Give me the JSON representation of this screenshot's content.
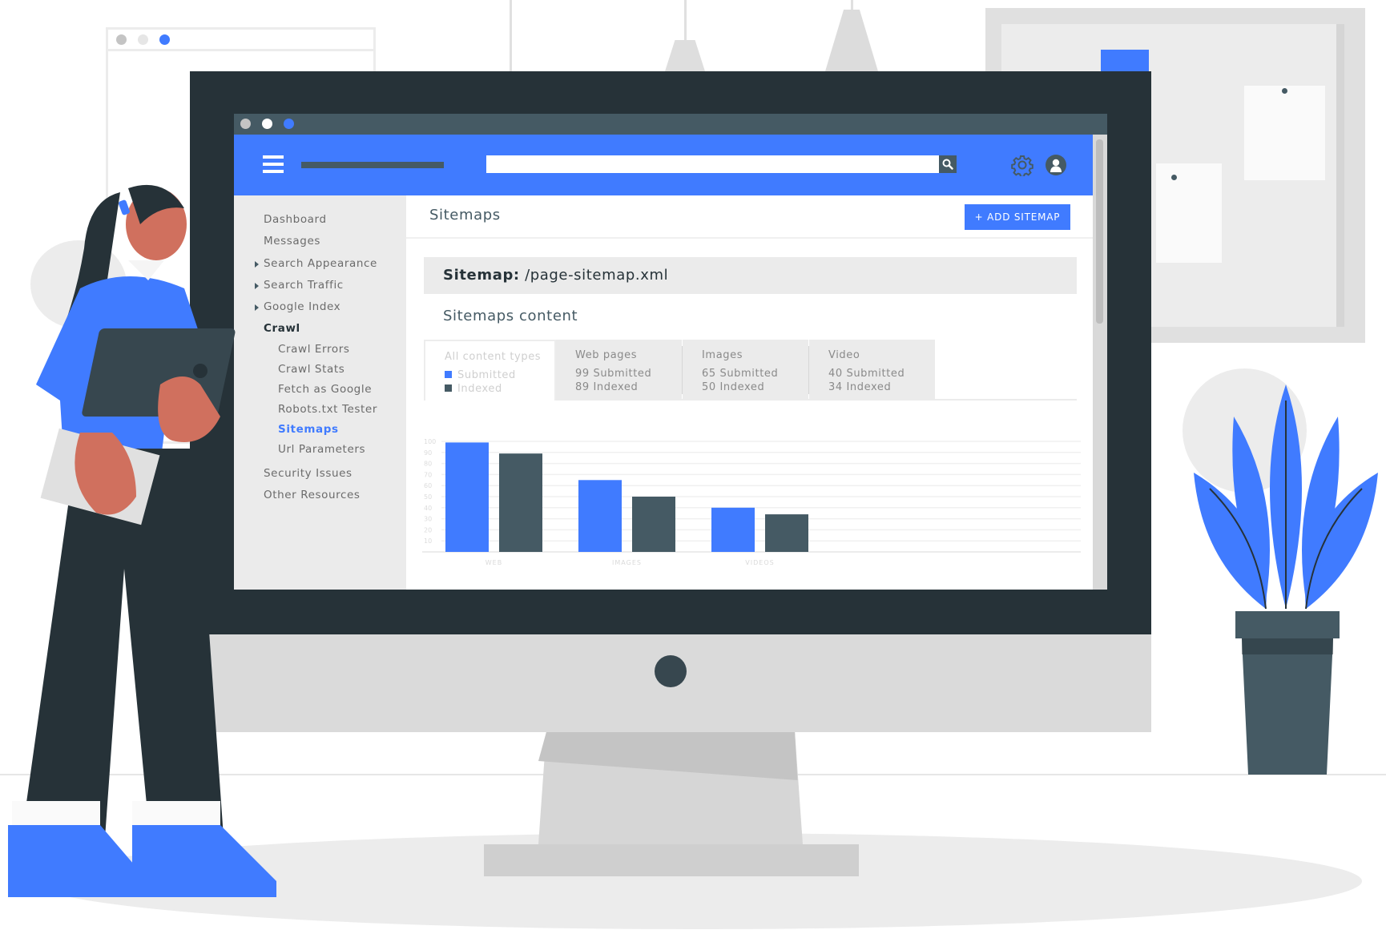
{
  "window": {
    "dots": [
      {
        "name": "close",
        "color": "#c4c4c4"
      },
      {
        "name": "minimize",
        "color": "#ffffff"
      },
      {
        "name": "maximize",
        "color": "#407bff"
      }
    ]
  },
  "colors": {
    "accent": "#407bff",
    "dark": "#455a64",
    "frame": "#263238",
    "sidebar_bg": "#ebebeb"
  },
  "header": {
    "search": {
      "value": "",
      "placeholder": ""
    },
    "icons": [
      "menu-icon",
      "search-icon",
      "gear-icon",
      "user-avatar-icon"
    ]
  },
  "sidebar": {
    "items": [
      {
        "label": "Dashboard",
        "type": "item"
      },
      {
        "label": "Messages",
        "type": "item"
      },
      {
        "label": "Search Appearance",
        "type": "collapsible"
      },
      {
        "label": "Search Traffic",
        "type": "collapsible"
      },
      {
        "label": "Google Index",
        "type": "collapsible"
      },
      {
        "label": "Crawl",
        "type": "group"
      },
      {
        "label": "Crawl Errors",
        "type": "sub"
      },
      {
        "label": "Crawl Stats",
        "type": "sub"
      },
      {
        "label": "Fetch as Google",
        "type": "sub"
      },
      {
        "label": "Robots.txt Tester",
        "type": "sub"
      },
      {
        "label": "Sitemaps",
        "type": "sub",
        "active": true
      },
      {
        "label": "Url Parameters",
        "type": "sub"
      },
      {
        "label": "Security Issues",
        "type": "item"
      },
      {
        "label": "Other Resources",
        "type": "item"
      }
    ]
  },
  "main": {
    "title": "Sitemaps",
    "add_button": "+ ADD SITEMAP",
    "sitemap_prefix": "Sitemap:",
    "sitemap_path": "/page-sitemap.xml",
    "content_title": "Sitemaps content",
    "tabs": [
      {
        "title": "All content types",
        "line1": "Submitted",
        "line2": "Indexed",
        "legend": true
      },
      {
        "title": "Web pages",
        "line1": "99  Submitted",
        "line2": "89 Indexed"
      },
      {
        "title": "Images",
        "line1": "65  Submitted",
        "line2": "50 Indexed"
      },
      {
        "title": "Video",
        "line1": "40  Submitted",
        "line2": "34 Indexed"
      }
    ]
  },
  "chart_data": {
    "type": "bar",
    "title": "",
    "xlabel": "",
    "ylabel": "",
    "categories": [
      "WEB",
      "IMAGES",
      "VIDEOS"
    ],
    "series": [
      {
        "name": "Submitted",
        "color": "#407bff",
        "values": [
          99,
          65,
          40
        ]
      },
      {
        "name": "Indexed",
        "color": "#455a64",
        "values": [
          89,
          50,
          34
        ]
      }
    ],
    "yticks": [
      10,
      20,
      30,
      40,
      50,
      60,
      70,
      80,
      90,
      100
    ],
    "ylim": [
      0,
      100
    ],
    "grid": true,
    "legend": "none"
  }
}
